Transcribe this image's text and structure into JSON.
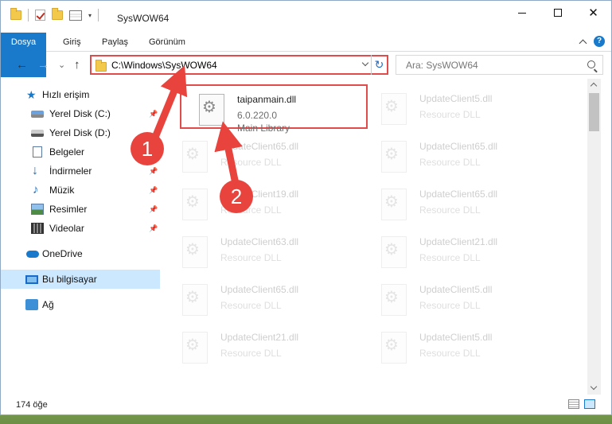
{
  "window": {
    "title": "SysWOW64",
    "qat_down_glyph": "▾"
  },
  "ribbon": {
    "tabs": [
      {
        "label": "Dosya"
      },
      {
        "label": "Giriş"
      },
      {
        "label": "Paylaş"
      },
      {
        "label": "Görünüm"
      }
    ],
    "help": "?"
  },
  "nav": {
    "back_glyph": "←",
    "forward_glyph": "→",
    "recent_glyph": "⌄",
    "up_glyph": "↑",
    "address": "C:\\Windows\\SysWOW64",
    "refresh_glyph": "↻",
    "search_placeholder": "Ara: SysWOW64"
  },
  "sidebar": {
    "quick_access": "Hızlı erişim",
    "items": [
      {
        "label": "Yerel Disk (C:)",
        "icon": "drive-c-icon",
        "pinned": true
      },
      {
        "label": "Yerel Disk (D:)",
        "icon": "drive-d-icon",
        "pinned": false
      },
      {
        "label": "Belgeler",
        "icon": "documents-icon",
        "pinned": true
      },
      {
        "label": "İndirmeler",
        "icon": "downloads-icon",
        "pinned": true
      },
      {
        "label": "Müzik",
        "icon": "music-icon",
        "pinned": true
      },
      {
        "label": "Resimler",
        "icon": "pictures-icon",
        "pinned": true
      },
      {
        "label": "Videolar",
        "icon": "videos-icon",
        "pinned": true
      }
    ],
    "onedrive": "OneDrive",
    "this_pc": "Bu bilgisayar",
    "network": "Ağ",
    "pin_glyph": "📌"
  },
  "files": [
    {
      "name": "taipanmain.dll",
      "line2": "6.0.220.0",
      "line3": "Main Library",
      "state": "highlighted"
    },
    {
      "name": "UpdateClient5.dll",
      "line2": "Resource DLL",
      "line3": "",
      "state": "faded"
    },
    {
      "name": "UpdateClient65.dll",
      "line2": "Resource DLL",
      "line3": "",
      "state": "faded"
    },
    {
      "name": "UpdateClient65.dll",
      "line2": "Resource DLL",
      "line3": "",
      "state": "faded"
    },
    {
      "name": "UpdateClient19.dll",
      "line2": "Resource DLL",
      "line3": "",
      "state": "faded"
    },
    {
      "name": "UpdateClient65.dll",
      "line2": "Resource DLL",
      "line3": "",
      "state": "faded"
    },
    {
      "name": "UpdateClient63.dll",
      "line2": "Resource DLL",
      "line3": "",
      "state": "faded"
    },
    {
      "name": "UpdateClient21.dll",
      "line2": "Resource DLL",
      "line3": "",
      "state": "faded"
    },
    {
      "name": "UpdateClient65.dll",
      "line2": "Resource DLL",
      "line3": "",
      "state": "faded"
    },
    {
      "name": "UpdateClient5.dll",
      "line2": "Resource DLL",
      "line3": "",
      "state": "faded"
    },
    {
      "name": "UpdateClient21.dll",
      "line2": "Resource DLL",
      "line3": "",
      "state": "faded"
    },
    {
      "name": "UpdateClient5.dll",
      "line2": "Resource DLL",
      "line3": "",
      "state": "faded"
    }
  ],
  "status": {
    "count": "174 öğe"
  },
  "annotations": [
    {
      "number": "1"
    },
    {
      "number": "2"
    }
  ],
  "colors": {
    "accent": "#1979ca",
    "highlight_border": "#e04b4b",
    "arrow": "#e8443d",
    "selected_bg": "#cce8ff"
  }
}
